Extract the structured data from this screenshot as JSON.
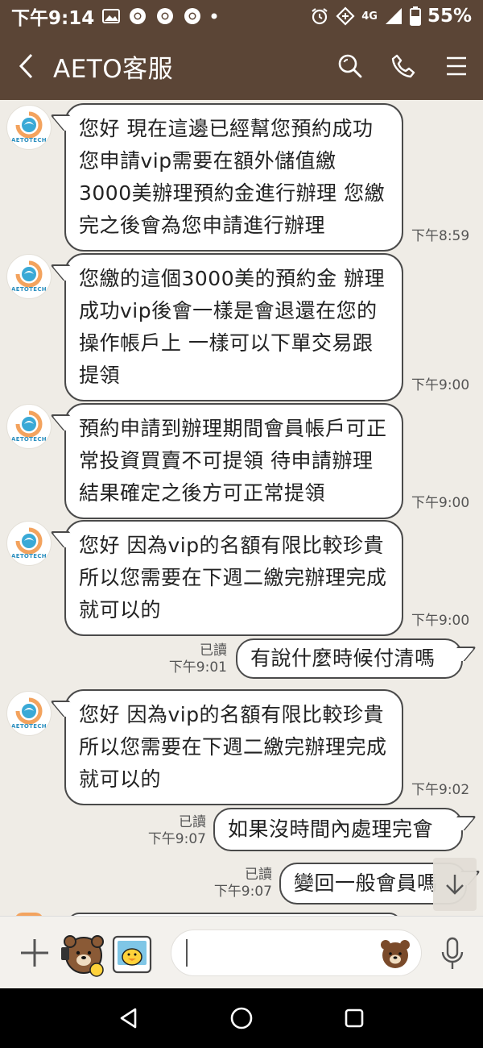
{
  "status_bar": {
    "time": "下午9:14",
    "network": "4G",
    "battery": "55%",
    "icons": [
      "image-icon",
      "chrome-icon",
      "chrome-icon",
      "chrome-icon",
      "dot-icon",
      "alarm-icon",
      "data-saver-icon",
      "signal-icon",
      "battery-icon"
    ]
  },
  "header": {
    "title": "AETO客服",
    "icons": [
      "back-icon",
      "search-icon",
      "phone-icon",
      "menu-icon"
    ]
  },
  "avatar_label": "AETOTECH",
  "messages": [
    {
      "side": "in",
      "text": "您好 現在這邊已經幫您預約成功 您申請vip需要在額外儲值繳3000美辦理預約金進行辦理 您繳完之後會為您申請進行辦理",
      "time": "下午8:59"
    },
    {
      "side": "in",
      "text": "您繳的這個3000美的預約金 辦理成功vip後會一樣是會退還在您的操作帳戶上 一樣可以下單交易跟提領",
      "time": "下午9:00"
    },
    {
      "side": "in",
      "text": "預約申請到辦理期間會員帳戶可正常投資買賣不可提領  待申請辦理結果確定之後方可正常提領",
      "time": "下午9:00"
    },
    {
      "side": "in",
      "text": "您好 因為vip的名額有限比較珍貴 所以您需要在下週二繳完辦理完成就可以的",
      "time": "下午9:00"
    },
    {
      "side": "out",
      "text": "有說什麼時候付清嗎",
      "read": "已讀",
      "time": "下午9:01"
    },
    {
      "side": "in",
      "text": "您好 因為vip的名額有限比較珍貴 所以您需要在下週二繳完辦理完成就可以的",
      "time": "下午9:02"
    },
    {
      "side": "out",
      "text": "如果沒時間內處理完會",
      "read": "已讀",
      "time": "下午9:07"
    },
    {
      "side": "out",
      "text": "變回一般會員嗎",
      "read": "已讀",
      "time": "下午9:07"
    }
  ],
  "input_bar": {
    "value": "",
    "icons": [
      "plus-icon",
      "sticker-icon",
      "photo-icon",
      "emoji-icon",
      "mic-icon"
    ]
  },
  "nav_bar": {
    "icons": [
      "nav-back-icon",
      "nav-home-icon",
      "nav-recents-icon"
    ]
  },
  "colors": {
    "header_bg": "#5b4536",
    "chat_bg": "#efece6",
    "bubble_bg": "#ffffff",
    "bubble_border": "#4a4a4a"
  }
}
